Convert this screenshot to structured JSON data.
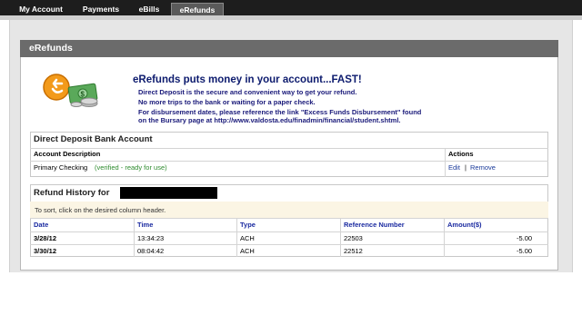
{
  "nav": {
    "tabs": [
      {
        "label": "My Account"
      },
      {
        "label": "Payments"
      },
      {
        "label": "eBills"
      },
      {
        "label": "eRefunds"
      }
    ]
  },
  "panel": {
    "title": "eRefunds"
  },
  "promo": {
    "title": "eRefunds puts money in your account...FAST!",
    "lines": [
      "Direct Deposit is the secure and convenient way to get your refund.",
      "No more trips to the bank or waiting for a paper check.",
      "For disbursement dates, please reference the link \"Excess Funds Disbursement\" found",
      "on the Bursary page at http://www.valdosta.edu/finadmin/financial/student.shtml."
    ],
    "icon": "money-refund-icon"
  },
  "direct_deposit": {
    "title": "Direct Deposit Bank Account",
    "col_description": "Account Description",
    "col_actions": "Actions",
    "account_name": "Primary Checking",
    "account_status": "(verified - ready for use)",
    "edit_label": "Edit",
    "separator": "|",
    "remove_label": "Remove"
  },
  "refund_history": {
    "title": "Refund History for",
    "sort_note": "To sort, click on the desired column header.",
    "columns": [
      "Date",
      "Time",
      "Type",
      "Reference Number",
      "Amount($)"
    ],
    "rows": [
      {
        "date": "3/28/12",
        "time": "13:34:23",
        "type": "ACH",
        "ref": "22503",
        "amount": "-5.00"
      },
      {
        "date": "3/30/12",
        "time": "08:04:42",
        "type": "ACH",
        "ref": "22512",
        "amount": "-5.00"
      }
    ]
  },
  "colors": {
    "nav_bg": "#1d1d1d",
    "header_bg": "#6b6b6b",
    "promo_text": "#0d1b6e",
    "link": "#1a3a9a",
    "verified": "#2e8b2e",
    "note_bg": "#fbf5e4"
  }
}
